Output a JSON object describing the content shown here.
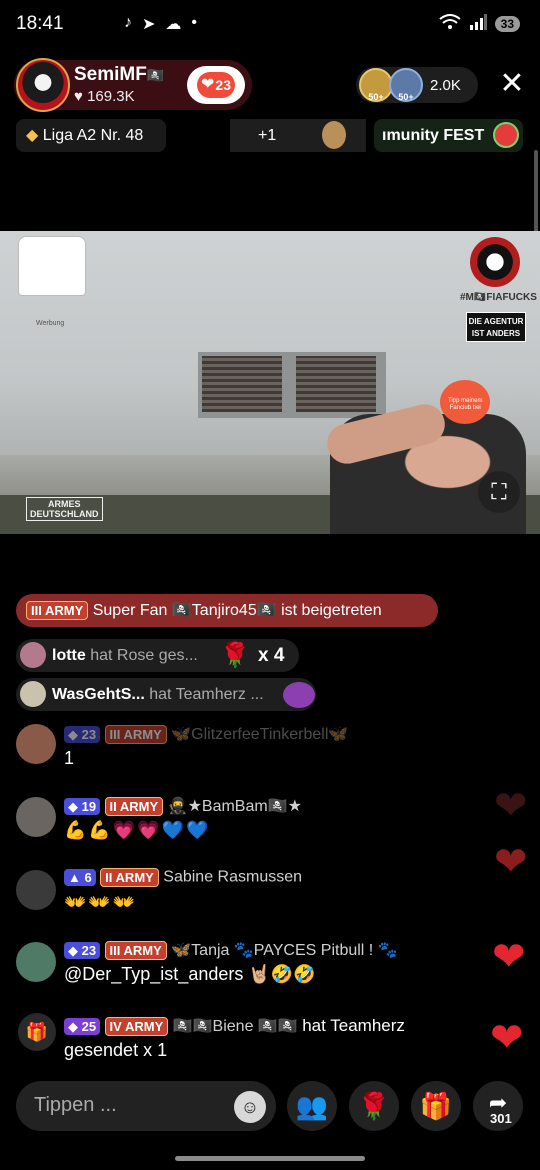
{
  "status_bar": {
    "time": "18:41",
    "notification_icons": [
      "tiktok-icon",
      "telegram-icon",
      "weather-icon",
      "dot-icon"
    ],
    "signal": "wifi-6 signal",
    "battery": "33"
  },
  "host": {
    "name": "SemiMF",
    "name_suffix": "🏴‍☠️",
    "likes": "♥ 169.3K",
    "follow_count": "23"
  },
  "viewers": {
    "badge_a": "50+",
    "badge_b": "50+",
    "count": "2.0K"
  },
  "top_row": {
    "league": "Liga A2 Nr. 48",
    "league_icon": "diamond-icon",
    "plus": "+1",
    "community": "ımunity FEST"
  },
  "video": {
    "jersey_caption": "Werbung",
    "logo_text": "#M🏴‍☠️FIAFUCKS",
    "agency_line1": "DIE AGENTUR",
    "agency_line2": "IST ANDERS",
    "watermark_line1": "ARMES",
    "watermark_line2": "DEUTSCHLAND",
    "mascot_line1": "Tipp meinem",
    "mascot_line2": "Fanclub bei"
  },
  "join_banner": {
    "badge_level": "III",
    "badge_label": "ARMY",
    "text": "Super Fan 🏴‍☠️Tanjiro45🏴‍☠️ ist beigetreten"
  },
  "gifts": [
    {
      "user": "lotte",
      "action": "hat Rose",
      "trail": "ges...",
      "gift_icon": "rose-icon",
      "count": "x 4"
    },
    {
      "user": "WasGehtS...",
      "action": "hat Teamherz",
      "trail": "...",
      "gift_icon": "team-heart-icon"
    }
  ],
  "chat": [
    {
      "level": "23",
      "army": "III",
      "army_label": "ARMY",
      "name": "🦋GlitzerfeeTinkerbell🦋",
      "text": "1"
    },
    {
      "level": "19",
      "army": "II",
      "army_label": "ARMY",
      "name": "🥷★BamBam🏴‍☠️★",
      "text": "💪💪💗💗💙💙"
    },
    {
      "level": "6",
      "army": "II",
      "army_label": "ARMY",
      "name": "Sabine Rasmussen",
      "text": "👐👐👐"
    },
    {
      "level": "23",
      "army": "III",
      "army_label": "ARMY",
      "name": "🦋Tanja 🐾PAYCES  Pitbull ! 🐾",
      "text": "@Der_Typ_ist_anders 🤘🏼🤣🤣"
    },
    {
      "level": "25",
      "army": "IV",
      "army_label": "ARMY",
      "name": "🏴‍☠️🏴‍☠️Biene 🏴‍☠️🏴‍☠️",
      "action": "hat Teamherz",
      "text": "gesendet x 1"
    }
  ],
  "bottom_bar": {
    "input_placeholder": "Tippen ...",
    "share_count": "301"
  },
  "colors": {
    "host_bg": "#3a0e13",
    "join_banner": "#8c2a2a",
    "army_badge": "#c2402c",
    "level_badge": "#4a4ed8",
    "heart_red": "#e3262f"
  }
}
